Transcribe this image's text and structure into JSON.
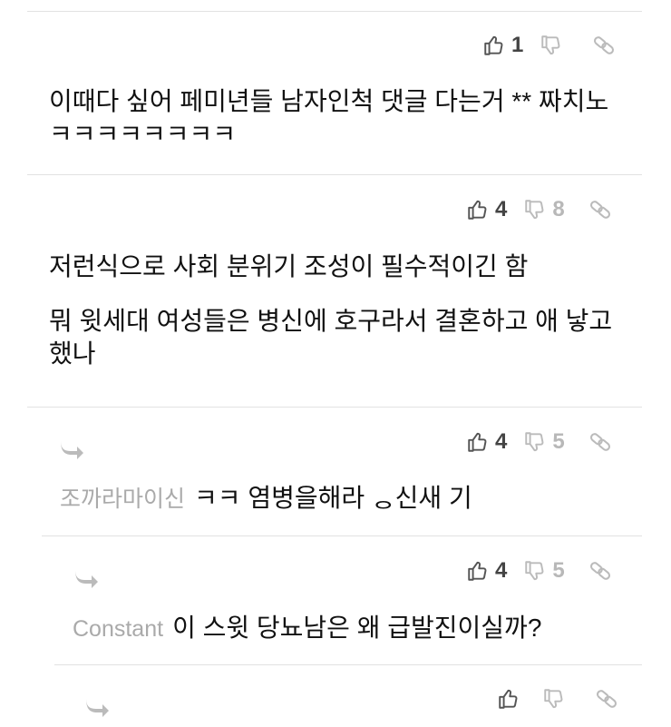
{
  "comments": [
    {
      "likes": "1",
      "dislikes": "",
      "paragraphs": [
        "이때다 싶어 페미년들 남자인척 댓글 다는거 ** 짜치노 ㅋㅋㅋㅋㅋㅋㅋㅋ"
      ]
    },
    {
      "likes": "4",
      "dislikes": "8",
      "paragraphs": [
        "저런식으로 사회 분위기 조성이 필수적이긴 함",
        "뭐 윗세대 여성들은 병신에 호구라서 결혼하고 애 낳고 했나"
      ]
    },
    {
      "likes": "4",
      "dislikes": "5",
      "author": "조까라마이신",
      "text": "ㅋㅋ 염병을해라 ᆼ신새 기"
    },
    {
      "likes": "4",
      "dislikes": "5",
      "author": "Constant",
      "text": "이 스윗 당뇨남은 왜 급발진이실까?"
    },
    {
      "likes": "",
      "dislikes": ""
    }
  ],
  "icons": {
    "like": "thumbs-up-icon",
    "dislike": "thumbs-down-icon",
    "link": "link-icon",
    "reply": "reply-arrow-icon"
  },
  "colors": {
    "text": "#111111",
    "count_like": "#444444",
    "count_dislike": "#b8b8b8",
    "icon": "#bbbbbb",
    "divider": "#e2e2e2",
    "author": "#aaaaaa"
  }
}
